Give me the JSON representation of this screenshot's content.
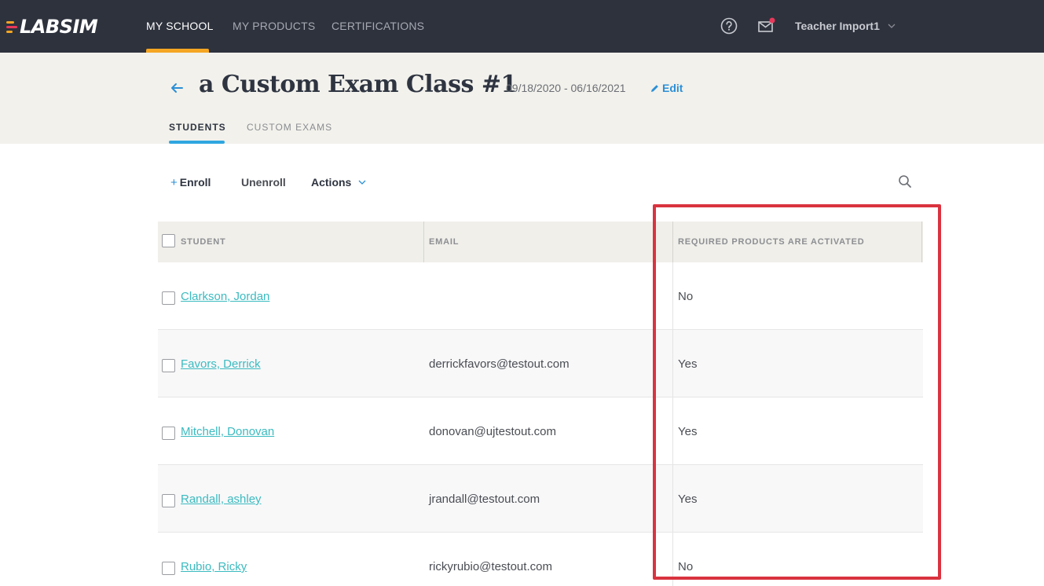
{
  "topnav": {
    "logo": "LABSIM",
    "items": [
      {
        "label": "MY SCHOOL",
        "active": true
      },
      {
        "label": "MY PRODUCTS",
        "active": false
      },
      {
        "label": "CERTIFICATIONS",
        "active": false
      }
    ],
    "user_name": "Teacher Import1",
    "icons": [
      "help-icon",
      "mail-icon",
      "chevron-down-icon"
    ],
    "accent": "#f5a623",
    "notification_dot": "#e8385a"
  },
  "header": {
    "title": "a Custom Exam Class #1",
    "date_range": "09/18/2020 - 06/16/2021",
    "edit_label": "Edit",
    "tabs": [
      {
        "label": "STUDENTS",
        "active": true
      },
      {
        "label": "CUSTOM EXAMS",
        "active": false
      }
    ]
  },
  "toolbar": {
    "enroll_plus": "+",
    "enroll_label": "Enroll",
    "unenroll_label": "Unenroll",
    "actions_label": "Actions"
  },
  "table": {
    "columns": [
      "STUDENT",
      "EMAIL",
      "REQUIRED PRODUCTS ARE ACTIVATED"
    ],
    "rows": [
      {
        "student": "Clarkson, Jordan",
        "email": "",
        "required": "No"
      },
      {
        "student": "Favors, Derrick",
        "email": "derrickfavors@testout.com",
        "required": "Yes"
      },
      {
        "student": "Mitchell, Donovan",
        "email": "donovan@ujtestout.com",
        "required": "Yes"
      },
      {
        "student": "Randall, ashley",
        "email": "jrandall@testout.com",
        "required": "Yes"
      },
      {
        "student": "Rubio, Ricky",
        "email": "rickyrubio@testout.com",
        "required": "No"
      }
    ]
  },
  "colors": {
    "topbar": "#2e323d",
    "link": "#3bbbc0",
    "highlight": "#d9333f",
    "tab_accent": "#2fa6e0"
  }
}
